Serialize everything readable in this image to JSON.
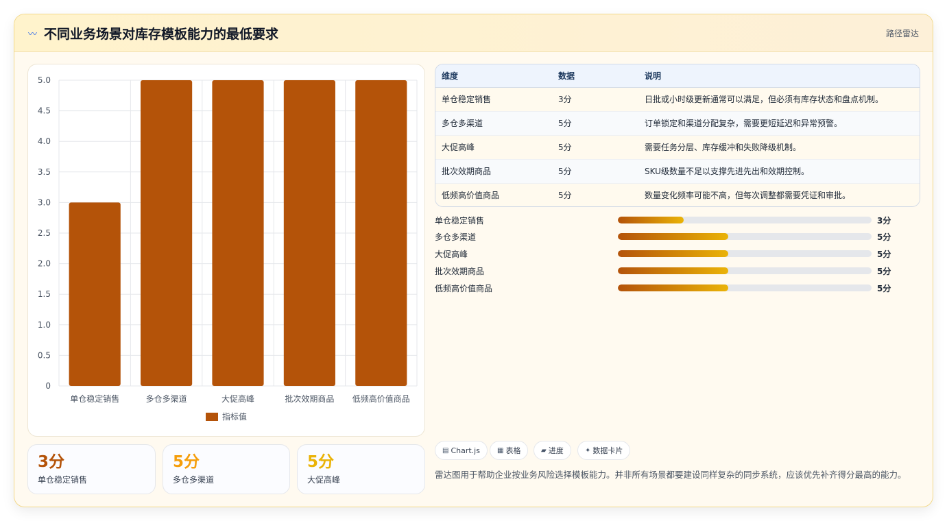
{
  "header": {
    "title": "不同业务场景对库存模板能力的最低要求",
    "link": "路径雷达",
    "icon": "wave-icon"
  },
  "chart_data": {
    "type": "bar",
    "categories": [
      "单仓稳定销售",
      "多仓多渠道",
      "大促高峰",
      "批次效期商品",
      "低频高价值商品"
    ],
    "series": [
      {
        "name": "指标值",
        "values": [
          3,
          5,
          5,
          5,
          5
        ],
        "color": "#b45309"
      }
    ],
    "ylim": [
      0,
      5
    ],
    "yticks": [
      "0",
      "0.5",
      "1.0",
      "1.5",
      "2.0",
      "2.5",
      "3.0",
      "3.5",
      "4.0",
      "4.5",
      "5.0"
    ],
    "legend": "bottom",
    "grid": true
  },
  "stats": [
    {
      "value": "3分",
      "label": "单仓稳定销售",
      "color": "#b45309"
    },
    {
      "value": "5分",
      "label": "多仓多渠道",
      "color": "#f59e0b"
    },
    {
      "value": "5分",
      "label": "大促高峰",
      "color": "#eab308"
    }
  ],
  "table": {
    "headers": [
      "维度",
      "数据",
      "说明"
    ],
    "rows": [
      {
        "dim": "单仓稳定销售",
        "data": "3分",
        "desc": "日批或小时级更新通常可以满足，但必须有库存状态和盘点机制。"
      },
      {
        "dim": "多仓多渠道",
        "data": "5分",
        "desc": "订单锁定和渠道分配复杂，需要更短延迟和异常预警。"
      },
      {
        "dim": "大促高峰",
        "data": "5分",
        "desc": "需要任务分层、库存缓冲和失败降级机制。"
      },
      {
        "dim": "批次效期商品",
        "data": "5分",
        "desc": "SKU级数量不足以支撑先进先出和效期控制。"
      },
      {
        "dim": "低频高价值商品",
        "data": "5分",
        "desc": "数量变化频率可能不高，但每次调整都需要凭证和审批。"
      }
    ]
  },
  "progress": [
    {
      "label": "单仓稳定销售",
      "value": "3分",
      "fraction": 0.26
    },
    {
      "label": "多仓多渠道",
      "value": "5分",
      "fraction": 0.435
    },
    {
      "label": "大促高峰",
      "value": "5分",
      "fraction": 0.435
    },
    {
      "label": "批次效期商品",
      "value": "5分",
      "fraction": 0.435
    },
    {
      "label": "低频高价值商品",
      "value": "5分",
      "fraction": 0.435
    }
  ],
  "pills": [
    {
      "icon": "chart-icon",
      "glyph": "▤",
      "label": "Chart.js"
    },
    {
      "icon": "table-icon",
      "glyph": "▦",
      "label": "表格"
    },
    {
      "icon": "progress-icon",
      "glyph": "▰",
      "label": "进度"
    },
    {
      "icon": "sparkle-icon",
      "glyph": "✦",
      "label": "数据卡片"
    }
  ],
  "note": "雷达图用于帮助企业按业务风险选择模板能力。并非所有场景都要建设同样复杂的同步系统，应该优先补齐得分最高的能力。"
}
